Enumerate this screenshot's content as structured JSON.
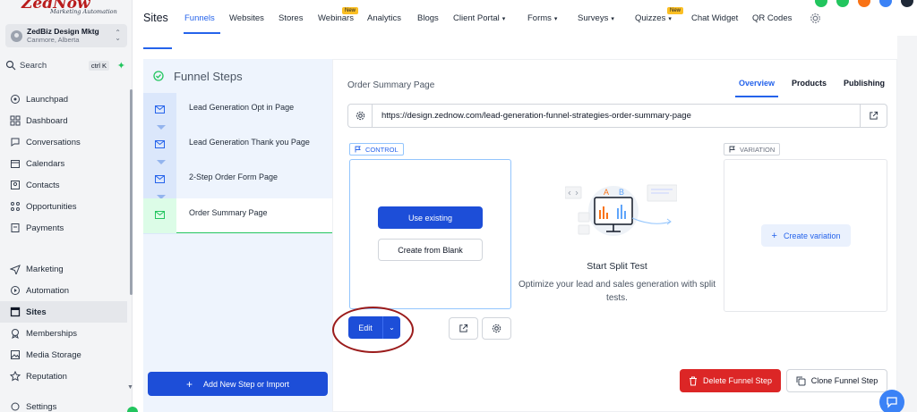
{
  "brand": {
    "logo_main": "ZedNow",
    "logo_sub": "Marketing Automation"
  },
  "account": {
    "name": "ZedBiz Design Mktg",
    "location": "Canmore, Alberta"
  },
  "search": {
    "label": "Search",
    "shortcut": "ctrl K"
  },
  "sidebar": {
    "items": [
      {
        "label": "Launchpad",
        "icon": "rocket-icon"
      },
      {
        "label": "Dashboard",
        "icon": "grid-icon"
      },
      {
        "label": "Conversations",
        "icon": "chat-icon"
      },
      {
        "label": "Calendars",
        "icon": "calendar-icon"
      },
      {
        "label": "Contacts",
        "icon": "contacts-icon"
      },
      {
        "label": "Opportunities",
        "icon": "opportunities-icon"
      },
      {
        "label": "Payments",
        "icon": "payments-icon"
      },
      {
        "label": "Marketing",
        "icon": "send-icon"
      },
      {
        "label": "Automation",
        "icon": "automation-icon"
      },
      {
        "label": "Sites",
        "icon": "sites-icon",
        "active": true
      },
      {
        "label": "Memberships",
        "icon": "memberships-icon"
      },
      {
        "label": "Media Storage",
        "icon": "image-icon"
      },
      {
        "label": "Reputation",
        "icon": "star-icon"
      },
      {
        "label": "Settings",
        "icon": "settings-icon"
      }
    ]
  },
  "topnav": {
    "title": "Sites",
    "tabs": [
      {
        "label": "Funnels",
        "active": true
      },
      {
        "label": "Websites"
      },
      {
        "label": "Stores"
      },
      {
        "label": "Webinars",
        "badge": "New"
      },
      {
        "label": "Analytics"
      },
      {
        "label": "Blogs"
      },
      {
        "label": "Client Portal",
        "dropdown": true
      },
      {
        "label": "Forms",
        "dropdown": true
      },
      {
        "label": "Surveys",
        "dropdown": true
      },
      {
        "label": "Quizzes",
        "dropdown": true,
        "badge": "New"
      },
      {
        "label": "Chat Widget"
      },
      {
        "label": "QR Codes"
      }
    ]
  },
  "funnel_steps": {
    "title": "Funnel Steps",
    "steps": [
      {
        "label": "Lead Generation Opt in Page"
      },
      {
        "label": "Lead Generation Thank you Page"
      },
      {
        "label": "2-Step Order Form Page"
      },
      {
        "label": "Order Summary Page",
        "active": true
      }
    ],
    "add_button": "Add New Step or Import"
  },
  "main": {
    "page_title": "Order Summary Page",
    "tabs": [
      "Overview",
      "Products",
      "Publishing"
    ],
    "active_tab": "Overview",
    "url": "https://design.zednow.com/lead-generation-funnel-strategies-order-summary-page",
    "control": {
      "tag": "CONTROL",
      "use_existing": "Use existing",
      "create_blank": "Create from Blank",
      "edit": "Edit"
    },
    "split_test": {
      "title": "Start Split Test",
      "description": "Optimize your lead and sales generation with split tests.",
      "illus_a": "A",
      "illus_b": "B"
    },
    "variation": {
      "tag": "VARIATION",
      "create": "Create variation"
    },
    "delete_step": "Delete Funnel Step",
    "clone_step": "Clone Funnel Step"
  },
  "colors": {
    "accent": "#2563eb",
    "primary_button": "#1d4ed8",
    "danger": "#dc2626",
    "success": "#22c55e",
    "annotation_ring": "#9b1c1c"
  }
}
